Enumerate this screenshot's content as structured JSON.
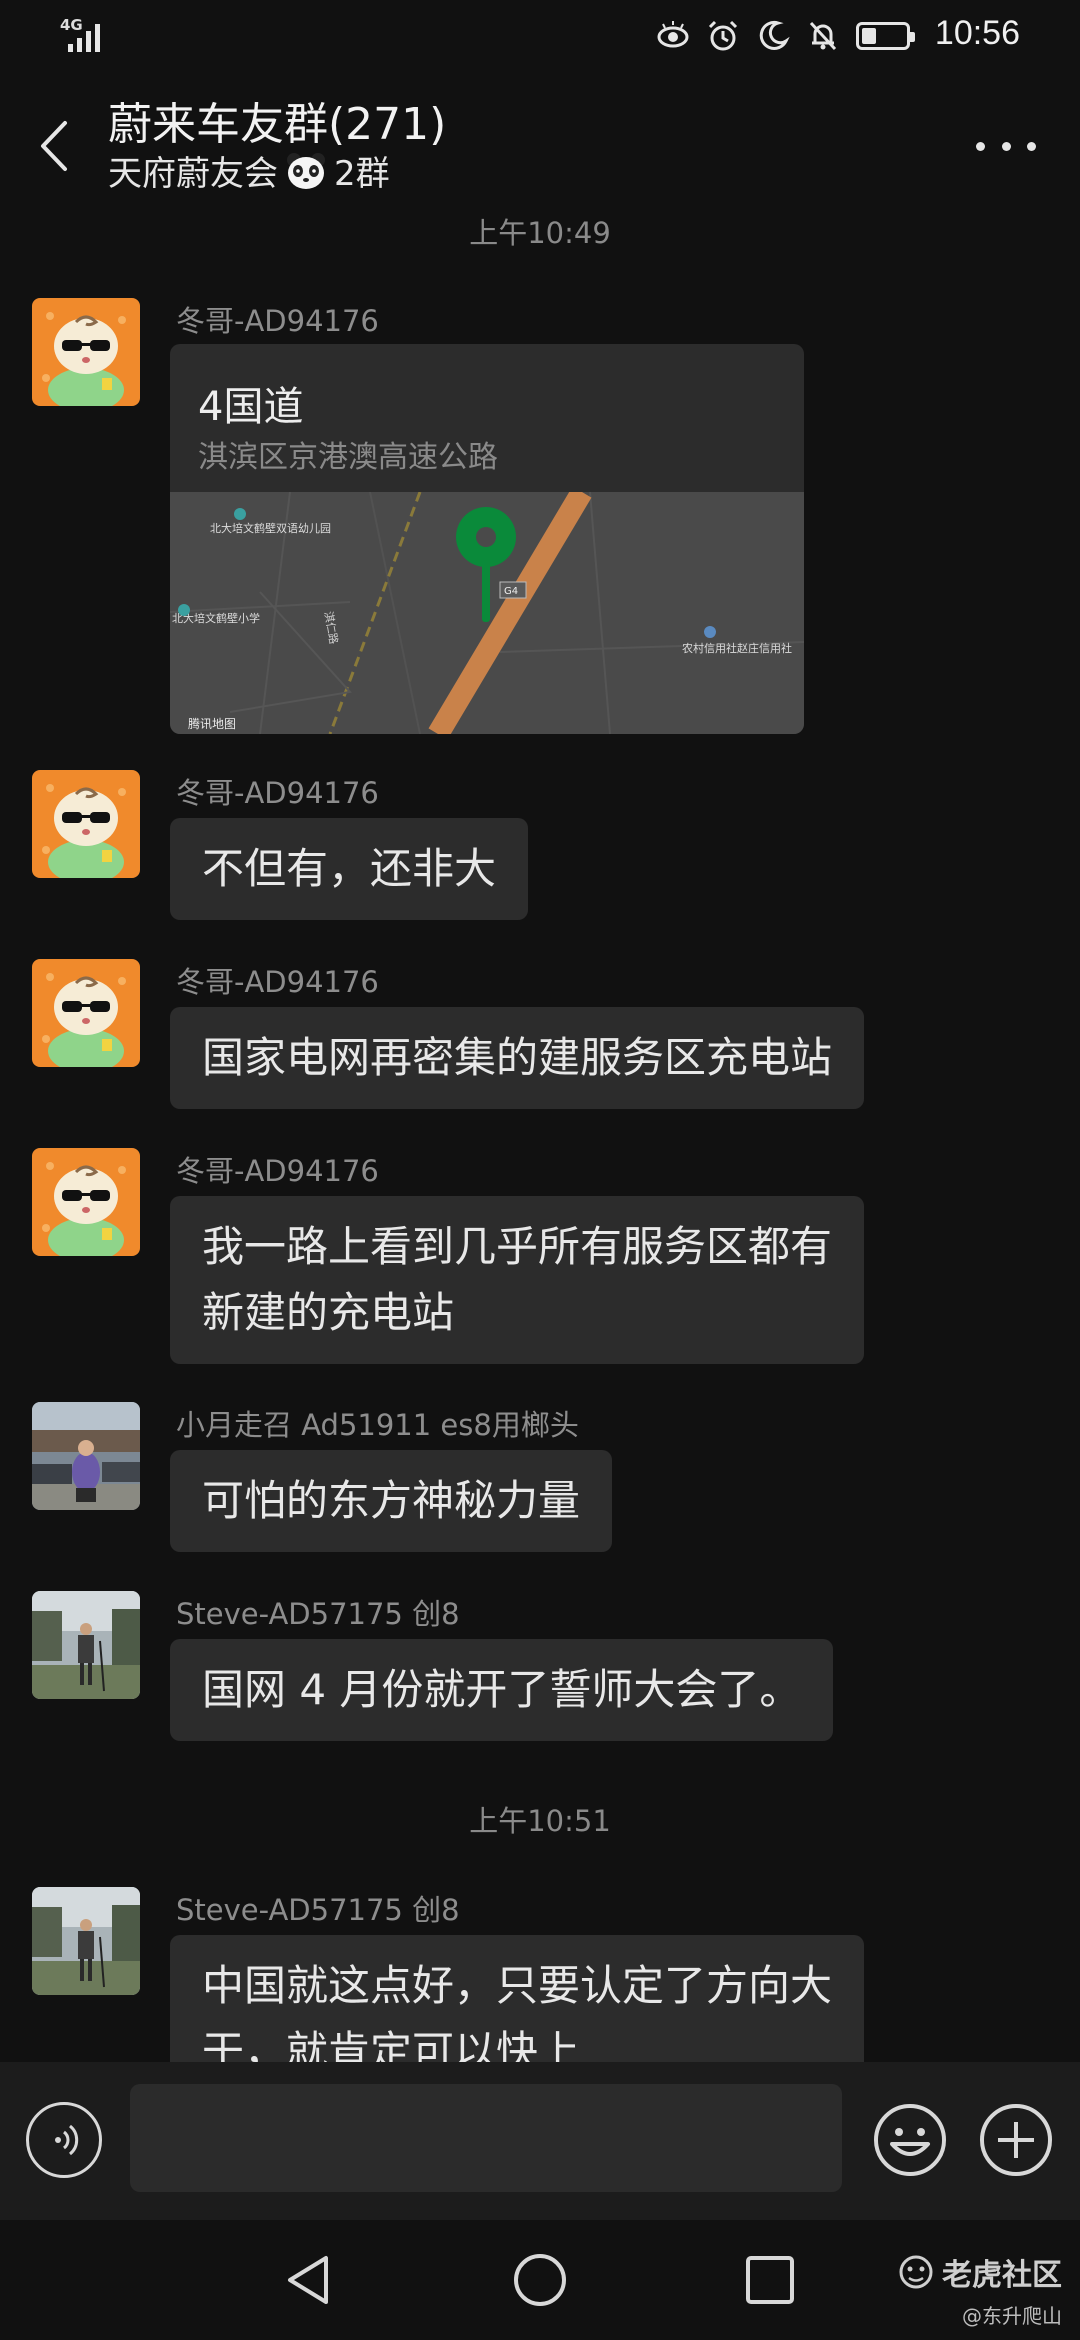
{
  "status_bar": {
    "network": "4G",
    "time": "10:56",
    "icons": [
      "eye-icon",
      "alarm-icon",
      "moon-icon",
      "bell-off-icon",
      "battery-icon"
    ]
  },
  "header": {
    "title": "蔚来车友群(271)",
    "subtitle_before": "天府蔚友会",
    "subtitle_after": "2群"
  },
  "timestamps": {
    "t1": "上午10:49",
    "t2": "上午10:51"
  },
  "messages": [
    {
      "sender": "冬哥-AD94176",
      "type": "location",
      "location_title": "4国道",
      "location_address": "淇滨区京港澳高速公路",
      "map_labels": {
        "kindergarten": "北大培文鹤壁双语幼儿园",
        "school": "北大培文鹤壁小学",
        "road": "淇仁路",
        "highway": "G4",
        "bank": "农村信用社赵庄信用社",
        "brand": "腾讯地图"
      }
    },
    {
      "sender": "冬哥-AD94176",
      "type": "text",
      "line1": "不但有，还非大"
    },
    {
      "sender": "冬哥-AD94176",
      "type": "text",
      "line1": "国家电网再密集的建服务区充电站"
    },
    {
      "sender": "冬哥-AD94176",
      "type": "text",
      "line1": "我一路上看到几乎所有服务区都有",
      "line2": "新建的充电站"
    },
    {
      "sender": "小月走召 Ad51911 es8用榔头",
      "type": "text",
      "line1": "可怕的东方神秘力量"
    },
    {
      "sender": "Steve-AD57175 创8",
      "type": "text",
      "line1": "国网 4 月份就开了誓师大会了。"
    },
    {
      "sender": "Steve-AD57175 创8",
      "type": "text",
      "line1": "中国就这点好，只要认定了方向大",
      "line2": "干，就肯定可以快上"
    }
  ],
  "input": {
    "placeholder": ""
  },
  "watermark": {
    "name": "老虎社区",
    "sub": "@东升爬山"
  },
  "colors": {
    "background": "#111111",
    "bubble": "#2c2c2c",
    "pin": "#0a8a3a",
    "road": "#c9824a"
  }
}
